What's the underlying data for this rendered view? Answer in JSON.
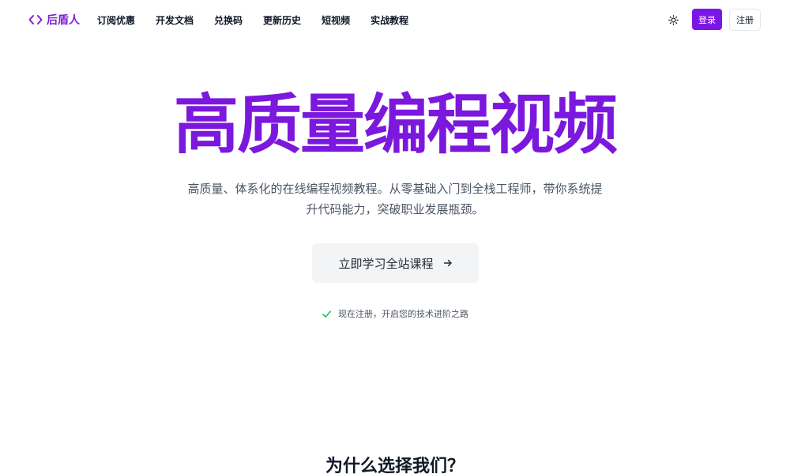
{
  "brand": {
    "name": "后盾人",
    "icon": "code-brackets-icon",
    "color": "#7e22ce"
  },
  "nav": {
    "links": [
      "订阅优惠",
      "开发文档",
      "兑换码",
      "更新历史",
      "短视频",
      "实战教程"
    ],
    "theme_icon": "sun-icon",
    "login_label": "登录",
    "register_label": "注册"
  },
  "hero": {
    "title": "高质量编程视频",
    "description": "高质量、体系化的在线编程视频教程。从零基础入门到全栈工程师，带你系统提升代码能力，突破职业发展瓶颈。",
    "cta_label": "立即学习全站课程",
    "cta_icon": "arrow-right-icon",
    "note": "现在注册，开启您的技术进阶之路",
    "note_icon": "check-icon"
  },
  "features": {
    "title": "为什么选择我们？"
  },
  "colors": {
    "accent": "#7c16e6",
    "check": "#22c55e"
  }
}
